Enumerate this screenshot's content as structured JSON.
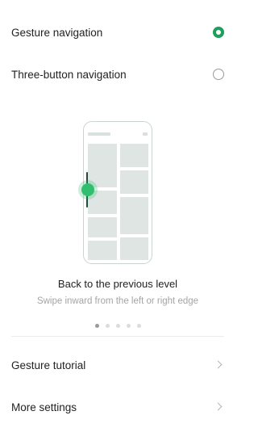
{
  "options": [
    {
      "label": "Gesture navigation",
      "selected": true
    },
    {
      "label": "Three-button navigation",
      "selected": false
    }
  ],
  "illustration": {
    "title": "Back to the previous level",
    "subtitle": "Swipe inward from the left or right edge"
  },
  "pager": {
    "pages": 5,
    "current": 1
  },
  "links": [
    {
      "label": "Gesture tutorial",
      "icon": "chevron-right-icon"
    },
    {
      "label": "More settings",
      "icon": "chevron-right-icon"
    }
  ],
  "colors": {
    "accent": "#1e9e5a",
    "swipe": "#2fbf6f"
  }
}
